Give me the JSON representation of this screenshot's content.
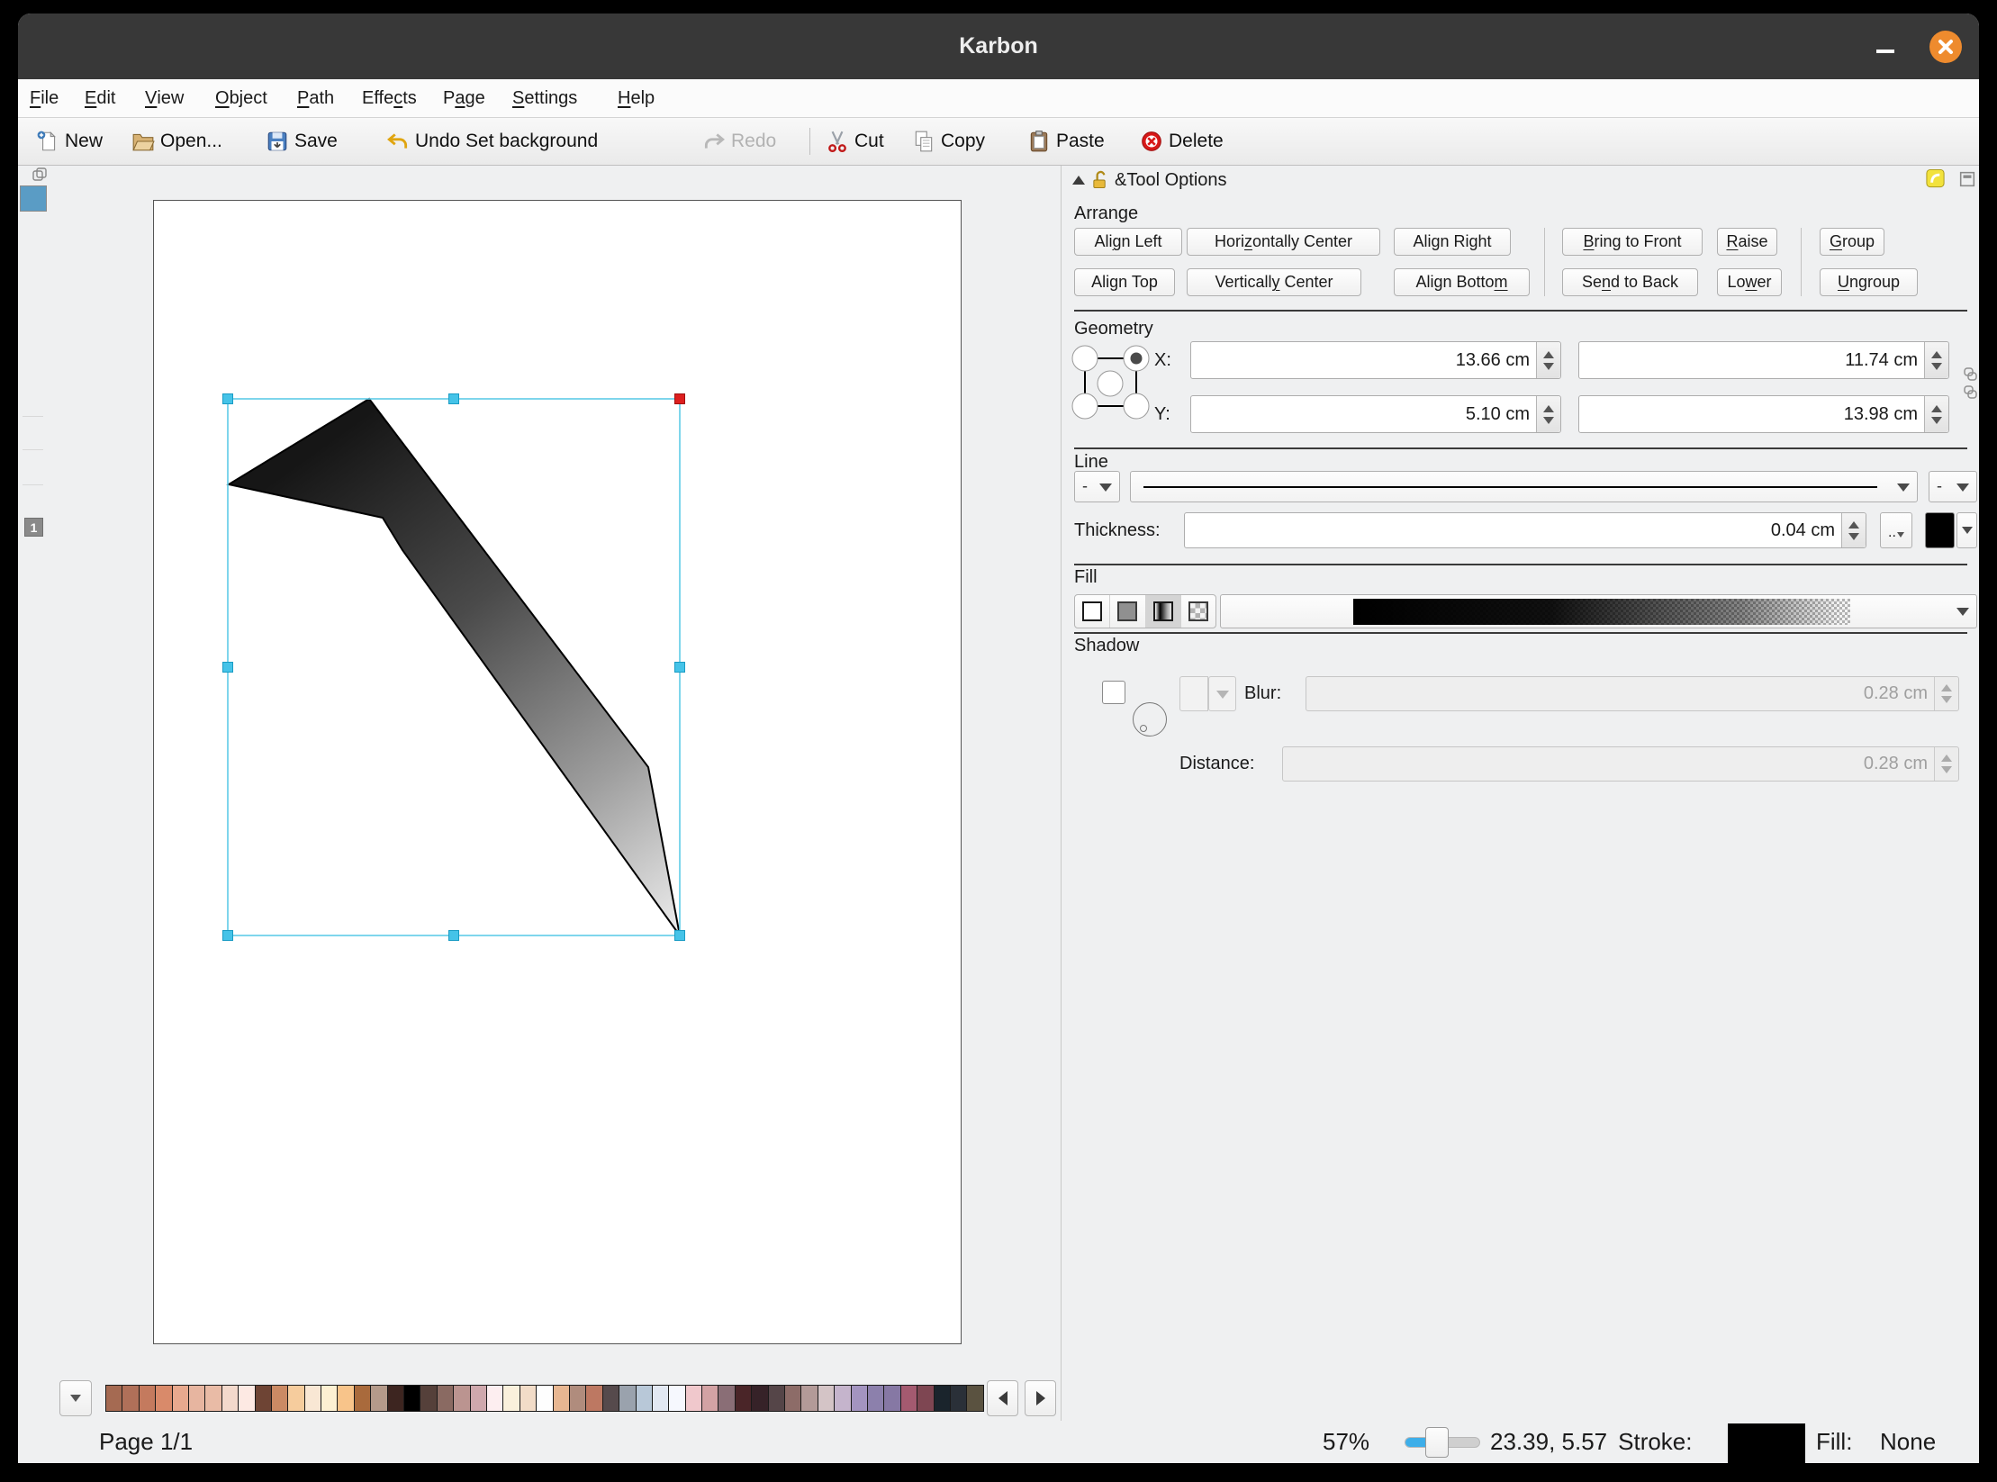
{
  "window": {
    "title": "Karbon"
  },
  "colors": {
    "titlebar": "#383838",
    "close_button": "#ee8b2e",
    "selection": "#45c3e8",
    "selection_hot": "#dd1f1f",
    "shape_gradient_start": "#161616",
    "shape_gradient_end": "#f4f4f4",
    "slider_accent": "#3daee9",
    "page_thumbnail": "#5a9cc5"
  },
  "menubar": {
    "items": [
      "&File",
      "&Edit",
      "&View",
      "&Object",
      "&Path",
      "Effe&cts",
      "P&age",
      "&Settings",
      "&Help"
    ]
  },
  "toolbar": {
    "items": [
      {
        "label": "New",
        "icon": "new-document-icon"
      },
      {
        "label": "Open...",
        "icon": "open-folder-icon"
      },
      {
        "label": "Save",
        "icon": "save-icon"
      },
      {
        "label": "Undo Set background",
        "icon": "undo-icon"
      },
      {
        "label": "Redo",
        "icon": "redo-icon"
      },
      {
        "label": "Cut",
        "icon": "cut-icon"
      },
      {
        "label": "Copy",
        "icon": "copy-icon"
      },
      {
        "label": "Paste",
        "icon": "paste-icon"
      },
      {
        "label": "Delete",
        "icon": "delete-icon"
      }
    ]
  },
  "canvas": {
    "page_number_badge": "1"
  },
  "tool_options": {
    "title": "&Tool Options",
    "arrange": {
      "label": "Arrange",
      "row1": [
        "Ali&gn Left",
        "Hori&zontally Center",
        "Align Right",
        "&Bring to Front",
        "&Raise",
        "&Group"
      ],
      "row2": [
        "Align Top",
        "Verticall&y Center",
        "Align Botto&m",
        "Se&nd to Back",
        "Lo&wer",
        "&Ungroup"
      ]
    },
    "geometry": {
      "label": "Geometry",
      "x_label": "X:",
      "y_label": "Y:",
      "x_value": "13.66 cm",
      "width_value": "11.74 cm",
      "y_value": "5.10 cm",
      "height_value": "13.98 cm"
    },
    "line": {
      "label": "Line",
      "start_cap": "-",
      "end_cap": "-",
      "thickness_label": "Thickness:",
      "thickness_value": "0.04 cm",
      "dash_editor_label": ".."
    },
    "fill": {
      "label": "Fill"
    },
    "shadow": {
      "label": "Shadow",
      "blur_label": "Blur:",
      "blur_value": "0.28 cm",
      "distance_label": "Distance:",
      "distance_value": "0.28 cm"
    }
  },
  "palette": {
    "colors": [
      "#a56a52",
      "#b07059",
      "#c47a5e",
      "#d98a6a",
      "#e8a98e",
      "#e7b5a0",
      "#e9bba6",
      "#f3d9cc",
      "#fde9e3",
      "#6e4434",
      "#cb8a64",
      "#f6cc9d",
      "#f9e7d4",
      "#fdf0d2",
      "#f8c48a",
      "#a96a3c",
      "#b49a8a",
      "#3d2520",
      "#000000",
      "#55403a",
      "#8a6a62",
      "#bb9490",
      "#cfa8ad",
      "#fdeef0",
      "#faf0dc",
      "#f2dcc8",
      "#fefefe",
      "#e8b792",
      "#b08c7d",
      "#bd7862",
      "#564a4c",
      "#9aa2ad",
      "#b8c8d8",
      "#e2e8f2",
      "#f6f8fe",
      "#f0c8cc",
      "#d3a2a4",
      "#8a6e76",
      "#4a2528",
      "#362228",
      "#554548",
      "#8d6c68",
      "#b39a98",
      "#d4c4c6",
      "#c5b4cc",
      "#a394c0",
      "#8c80ac",
      "#8678a4",
      "#a45a70",
      "#7e4652",
      "#1a242c",
      "#2a3038",
      "#5a5240"
    ]
  },
  "statusbar": {
    "page_indicator": "Page 1/1",
    "zoom_level": "57%",
    "cursor_position": "23.39, 5.57",
    "stroke_label": "Stroke:",
    "fill_label": "Fill:",
    "fill_value": "None"
  }
}
